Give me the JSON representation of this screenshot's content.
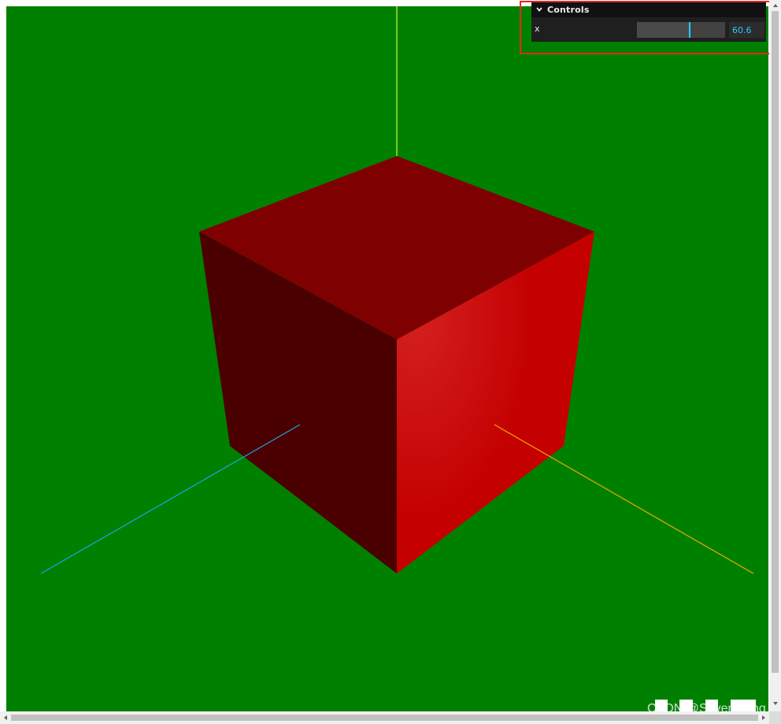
{
  "gui": {
    "title": "Controls",
    "controller": {
      "label": "x",
      "value": "60.6",
      "slider_fraction": 0.6
    }
  },
  "scene": {
    "background": "#008000",
    "cube_colors": {
      "top": "#7f0000",
      "left": "#4a0000",
      "right": "#c40000"
    },
    "axes_colors": {
      "y": "#a5e028",
      "z": "#1fa3e8",
      "x": "#f0a800"
    }
  },
  "watermark": {
    "text": "CSDN @Seven_Ting"
  }
}
